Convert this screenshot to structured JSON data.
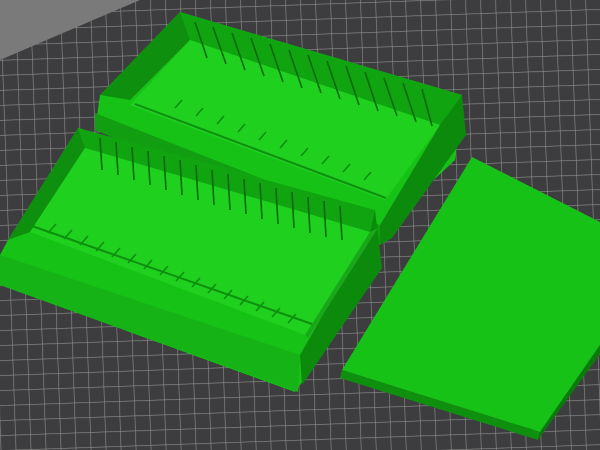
{
  "viewport": {
    "background_color": "#7a7a7a",
    "bed_color": "#3d3d3f",
    "bed_grid_color": "#8f8f8f",
    "model_color": "#17c217",
    "model_shadow_color": "#0e8f0e",
    "model_dark_color": "#0a6a0a",
    "model_light_color": "#2ee02e"
  },
  "objects": [
    {
      "name": "box-tray-back",
      "type": "divider-box"
    },
    {
      "name": "box-tray-front",
      "type": "divider-box"
    },
    {
      "name": "lid-plate",
      "type": "flat-lid"
    }
  ]
}
